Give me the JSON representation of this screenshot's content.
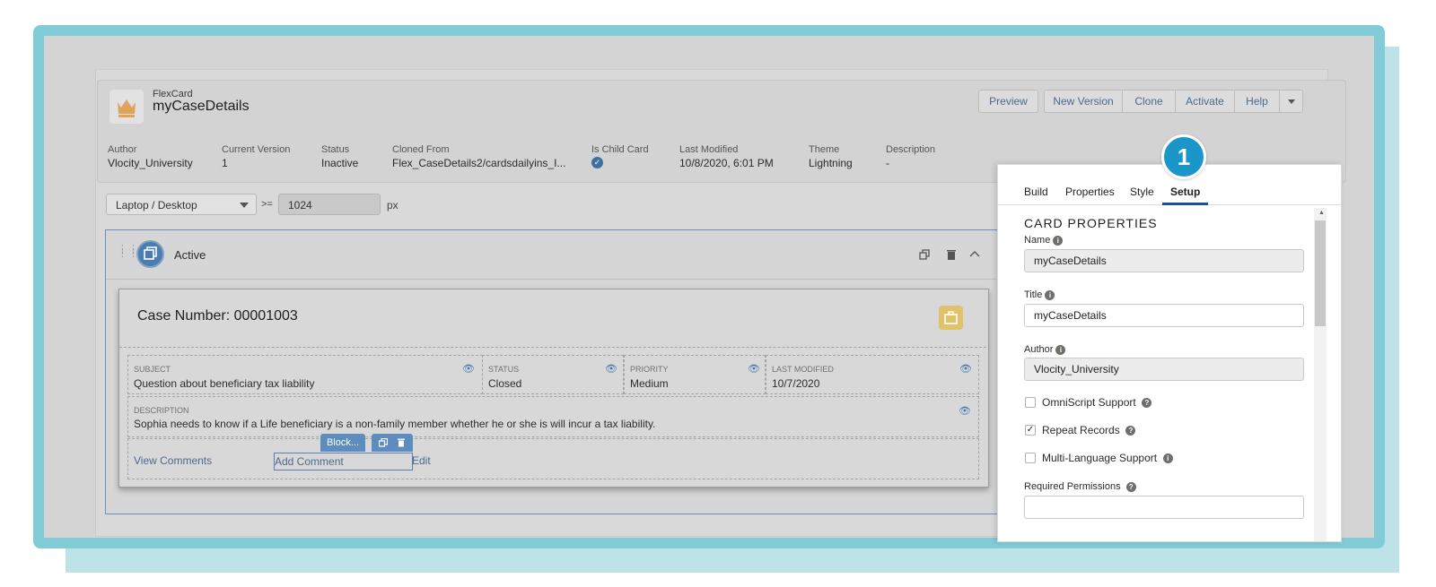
{
  "header": {
    "subtitle": "FlexCard",
    "title": "myCaseDetails",
    "buttons": [
      "Preview",
      "New Version",
      "Clone",
      "Activate",
      "Help"
    ],
    "meta": [
      {
        "label": "Author",
        "value": "Vlocity_University"
      },
      {
        "label": "Current Version",
        "value": "1"
      },
      {
        "label": "Status",
        "value": "Inactive"
      },
      {
        "label": "Cloned From",
        "value": "Flex_CaseDetails2/cardsdailyins_I..."
      },
      {
        "label": "Is Child Card",
        "value": ""
      },
      {
        "label": "Last Modified",
        "value": "10/8/2020, 6:01 PM"
      },
      {
        "label": "Theme",
        "value": "Lightning"
      },
      {
        "label": "Description",
        "value": "-"
      }
    ]
  },
  "viewport": {
    "device": "Laptop / Desktop",
    "operator": ">=",
    "width": "1024",
    "unit": "px"
  },
  "state": {
    "name": "Active"
  },
  "card": {
    "title": "Case Number: 00001003",
    "fields": [
      {
        "label": "SUBJECT",
        "value": "Question about beneficiary tax liability"
      },
      {
        "label": "STATUS",
        "value": "Closed"
      },
      {
        "label": "PRIORITY",
        "value": "Medium"
      },
      {
        "label": "LAST MODIFIED",
        "value": "10/7/2020"
      }
    ],
    "description_label": "DESCRIPTION",
    "description": "Sophia needs to know if a Life beneficiary is a non-family member whether he or she is will incur a tax liability.",
    "actions": [
      "View Comments",
      "Add Comment",
      "Edit"
    ],
    "block_label": "Block..."
  },
  "panel": {
    "badge": "1",
    "tabs": [
      "Build",
      "Properties",
      "Style",
      "Setup"
    ],
    "active_tab": "Setup",
    "section_title": "CARD PROPERTIES",
    "name_label": "Name",
    "name_value": "myCaseDetails",
    "title_label": "Title",
    "title_value": "myCaseDetails",
    "author_label": "Author",
    "author_value": "Vlocity_University",
    "checkboxes": [
      {
        "label": "OmniScript Support",
        "checked": false
      },
      {
        "label": "Repeat Records",
        "checked": true
      },
      {
        "label": "Multi-Language Support",
        "checked": false
      }
    ],
    "permissions_label": "Required Permissions",
    "permissions_value": ""
  },
  "colors": {
    "frame": "#82ccd8",
    "frame_shadow": "#bde3e9",
    "badge": "#1b96c9",
    "active_tab_underline": "#1b5297",
    "link": "#4a6a8f"
  }
}
